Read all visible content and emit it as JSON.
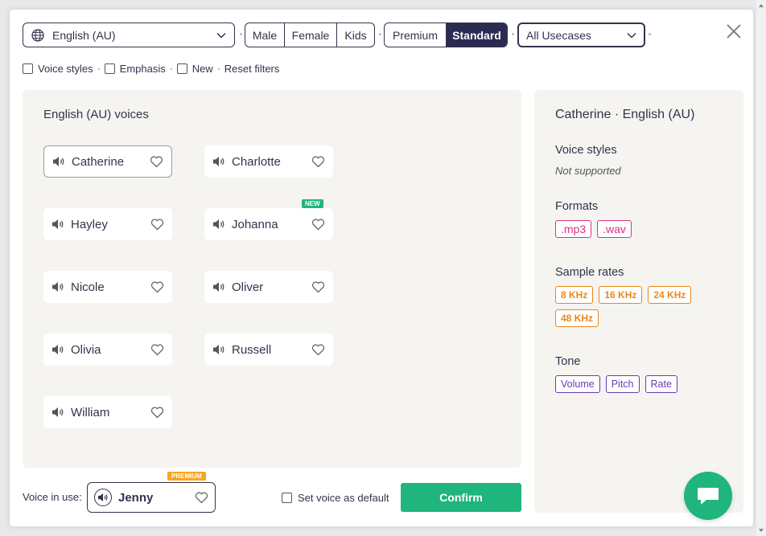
{
  "topbar": {
    "language": "English (AU)",
    "gender_options": [
      "Male",
      "Female",
      "Kids"
    ],
    "tier_options": [
      "Premium",
      "Standard"
    ],
    "tier_selected": "Standard",
    "usecase": "All Usecases"
  },
  "filters": {
    "voice_styles": "Voice styles",
    "emphasis": "Emphasis",
    "new": "New",
    "reset": "Reset filters"
  },
  "voices_panel": {
    "title": "English (AU) voices",
    "voices": [
      "Catherine",
      "Charlotte",
      "Hayley",
      "Johanna",
      "Nicole",
      "Oliver",
      "Olivia",
      "Russell",
      "William"
    ],
    "selected": "Catherine",
    "new_badge": "NEW"
  },
  "details": {
    "title": "Catherine · English (AU)",
    "voice_styles_label": "Voice styles",
    "voice_styles_value": "Not supported",
    "formats_label": "Formats",
    "formats": [
      ".mp3",
      ".wav"
    ],
    "sample_rates_label": "Sample rates",
    "sample_rates": [
      "8 KHz",
      "16 KHz",
      "24 KHz",
      "48 KHz"
    ],
    "tone_label": "Tone",
    "tone": [
      "Volume",
      "Pitch",
      "Rate"
    ]
  },
  "footer": {
    "voice_in_use_label": "Voice in use:",
    "voice_in_use": "Jenny",
    "premium_badge": "PREMIUM",
    "set_default": "Set voice as default",
    "confirm": "Confirm"
  },
  "colors": {
    "accent_green": "#1fb57c",
    "navy": "#2b2b52",
    "format_pink": "#e0307e",
    "rate_orange": "#e6891a",
    "tone_purple": "#6a3ab2"
  }
}
